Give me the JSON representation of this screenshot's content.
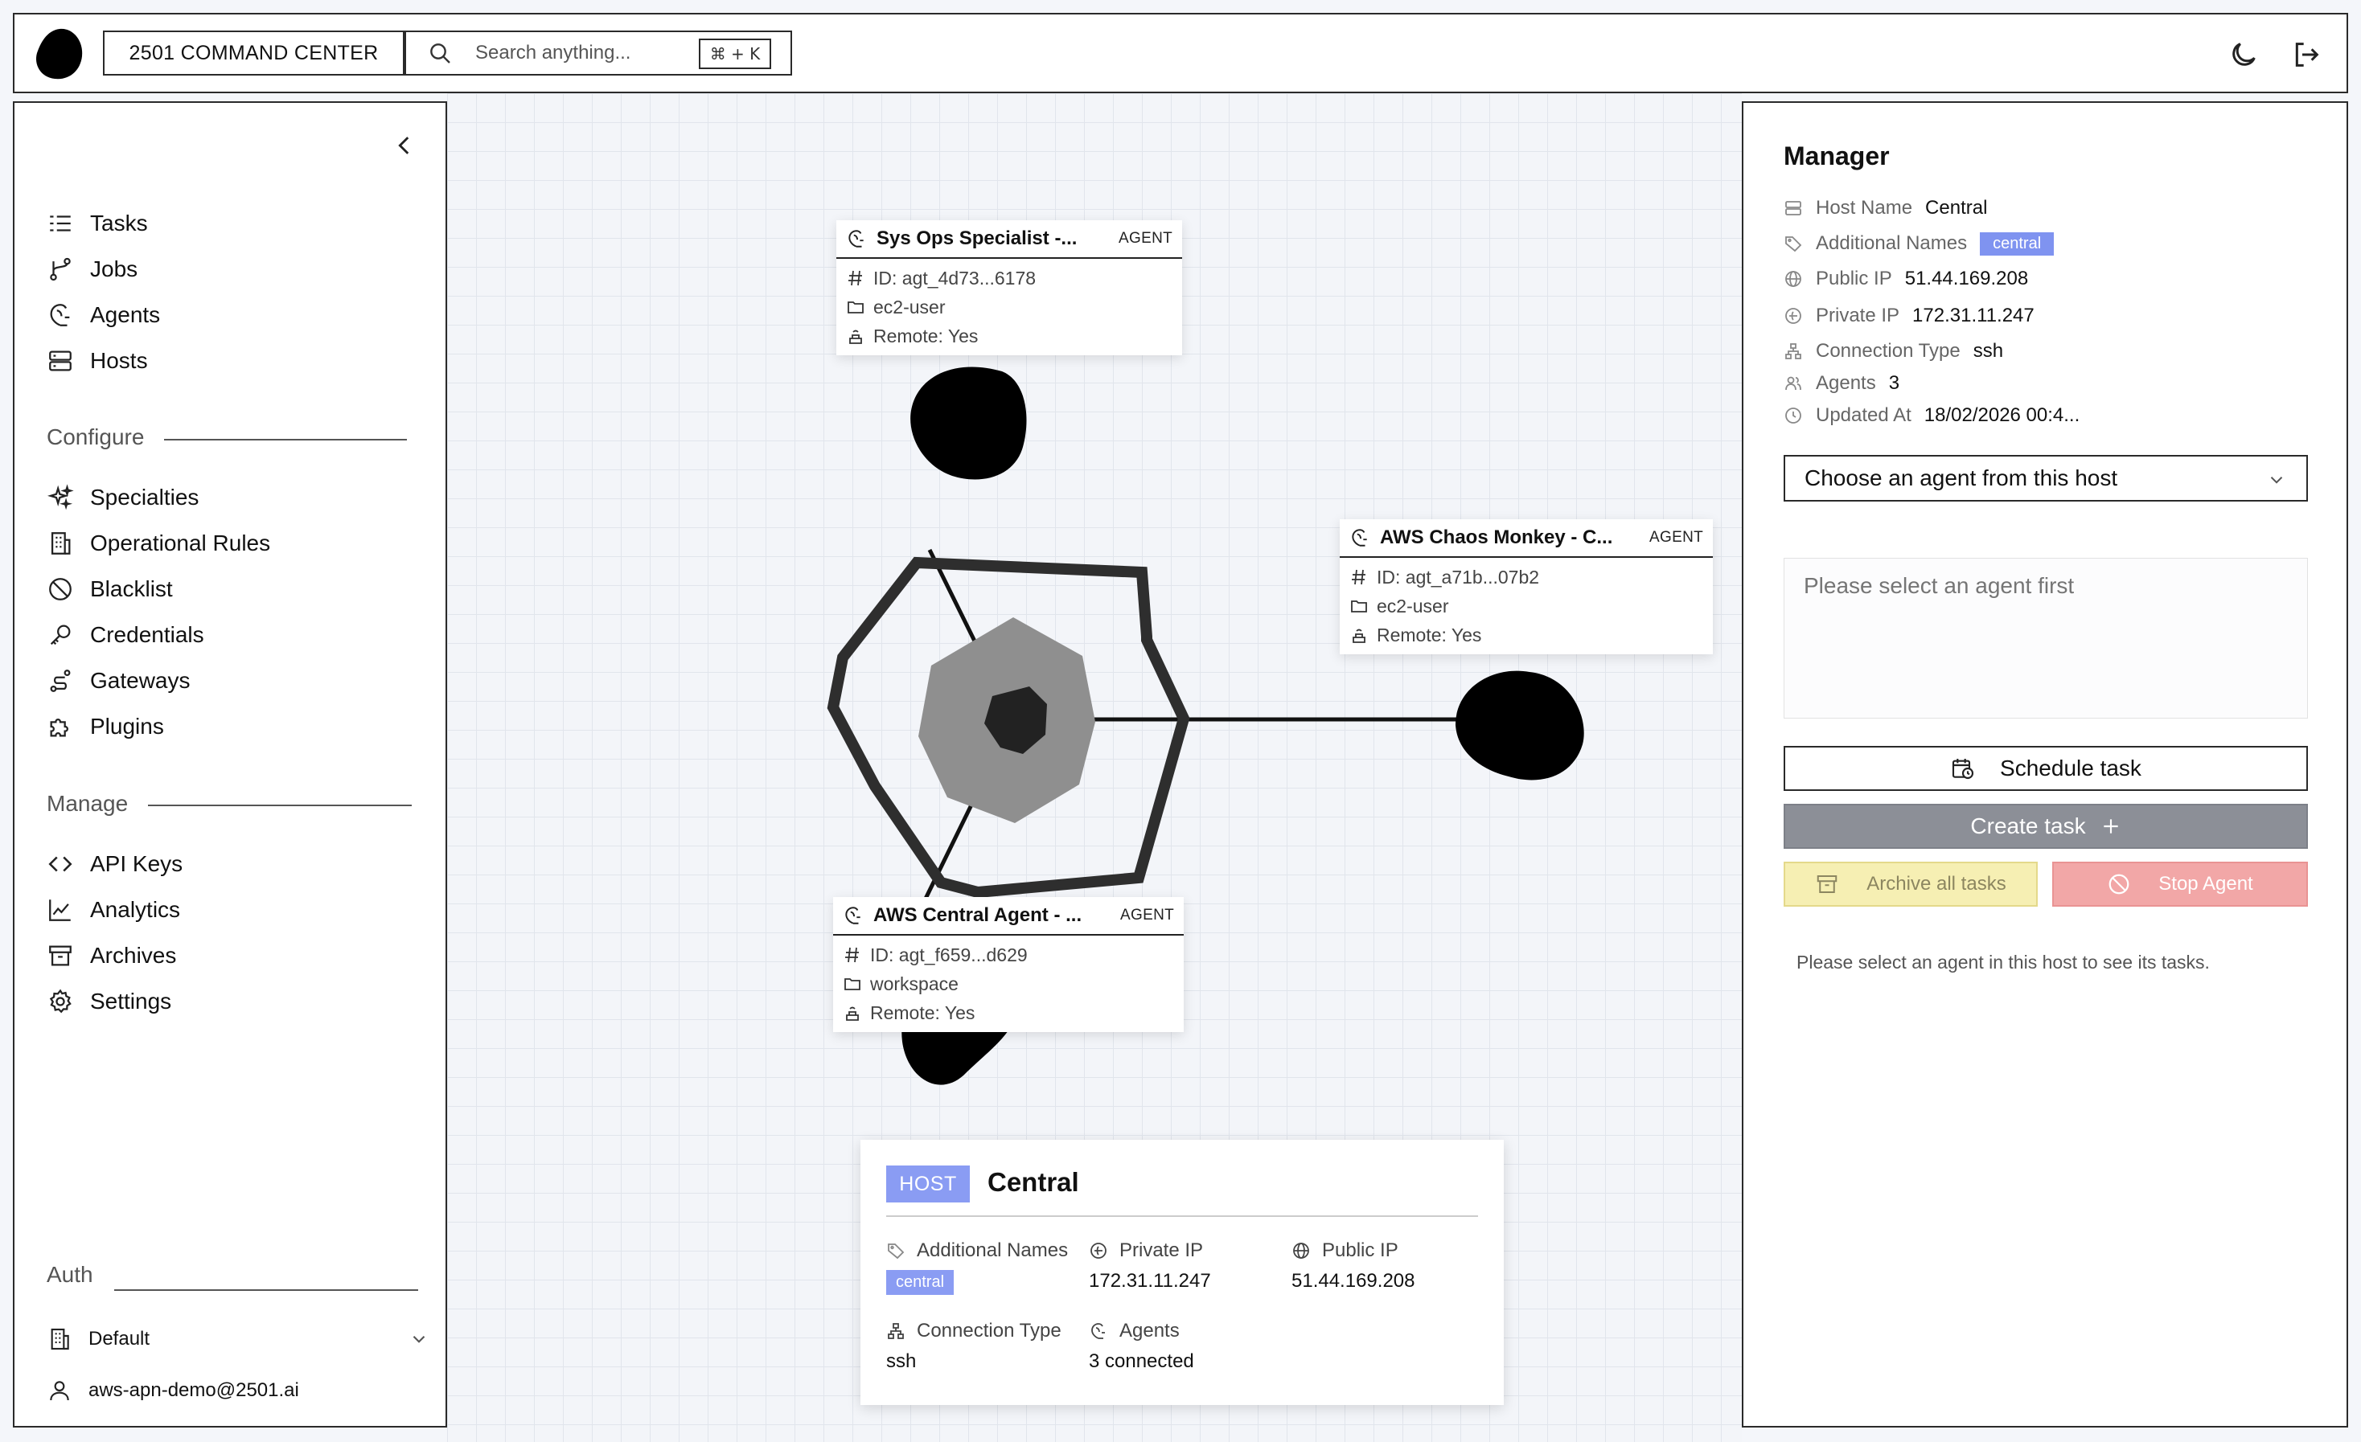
{
  "topbar": {
    "brand_label": "2501 COMMAND CENTER",
    "search_placeholder": "Search anything...",
    "search_shortcut": "⌘ + K",
    "icons": [
      "logo-blob",
      "search-icon",
      "moon-icon",
      "logout-icon"
    ]
  },
  "sidebar": {
    "items": [
      {
        "label": "Tasks",
        "icon": "list-icon"
      },
      {
        "label": "Jobs",
        "icon": "branch-icon"
      },
      {
        "label": "Agents",
        "icon": "agent-icon"
      },
      {
        "label": "Hosts",
        "icon": "server-icon"
      }
    ],
    "configure": {
      "label": "Configure",
      "items": [
        {
          "label": "Specialties",
          "icon": "sparkles-icon"
        },
        {
          "label": "Operational Rules",
          "icon": "building-icon"
        },
        {
          "label": "Blacklist",
          "icon": "ban-icon"
        },
        {
          "label": "Credentials",
          "icon": "key-icon"
        },
        {
          "label": "Gateways",
          "icon": "route-icon"
        },
        {
          "label": "Plugins",
          "icon": "puzzle-icon"
        }
      ]
    },
    "manage": {
      "label": "Manage",
      "items": [
        {
          "label": "API Keys",
          "icon": "code-icon"
        },
        {
          "label": "Analytics",
          "icon": "chart-line-icon"
        },
        {
          "label": "Archives",
          "icon": "archive-icon"
        },
        {
          "label": "Settings",
          "icon": "gear-icon"
        }
      ]
    },
    "auth": {
      "label": "Auth",
      "org": "Default",
      "user": "aws-apn-demo@2501.ai"
    }
  },
  "graph": {
    "agents": [
      {
        "name": "Sys Ops Specialist -...",
        "tag": "AGENT",
        "id": "ID: agt_4d73...6178",
        "user": "ec2-user",
        "remote": "Remote: Yes"
      },
      {
        "name": "AWS Chaos Monkey - C...",
        "tag": "AGENT",
        "id": "ID: agt_a71b...07b2",
        "user": "ec2-user",
        "remote": "Remote: Yes"
      },
      {
        "name": "AWS Central Agent - ...",
        "tag": "AGENT",
        "id": "ID: agt_f659...d629",
        "user": "workspace",
        "remote": "Remote: Yes"
      }
    ],
    "host": {
      "badge": "HOST",
      "name": "Central",
      "additional_names_label": "Additional Names",
      "additional_names_value": "central",
      "private_ip_label": "Private IP",
      "private_ip_value": "172.31.11.247",
      "public_ip_label": "Public IP",
      "public_ip_value": "51.44.169.208",
      "connection_type_label": "Connection Type",
      "connection_type_value": "ssh",
      "agents_label": "Agents",
      "agents_value": "3 connected"
    }
  },
  "manager": {
    "title": "Manager",
    "host_name_label": "Host Name",
    "host_name_value": "Central",
    "additional_names_label": "Additional Names",
    "additional_names_value": "central",
    "public_ip_label": "Public IP",
    "public_ip_value": "51.44.169.208",
    "private_ip_label": "Private IP",
    "private_ip_value": "172.31.11.247",
    "connection_type_label": "Connection Type",
    "connection_type_value": "ssh",
    "agents_label": "Agents",
    "agents_value": "3",
    "updated_at_label": "Updated At",
    "updated_at_value": "18/02/2026 00:4...",
    "agent_select": "Choose an agent from this host",
    "prompt_placeholder": "Please select an agent first",
    "schedule_label": "Schedule task",
    "create_label": "Create task",
    "archive_label": "Archive all tasks",
    "stop_label": "Stop Agent",
    "hint": "Please select an agent in this host to see its tasks."
  },
  "colors": {
    "accent": "#8a9cf3",
    "archive_bg": "#f6efb3",
    "stop_bg": "#f2a7a7",
    "create_bg": "#8c8f97"
  }
}
